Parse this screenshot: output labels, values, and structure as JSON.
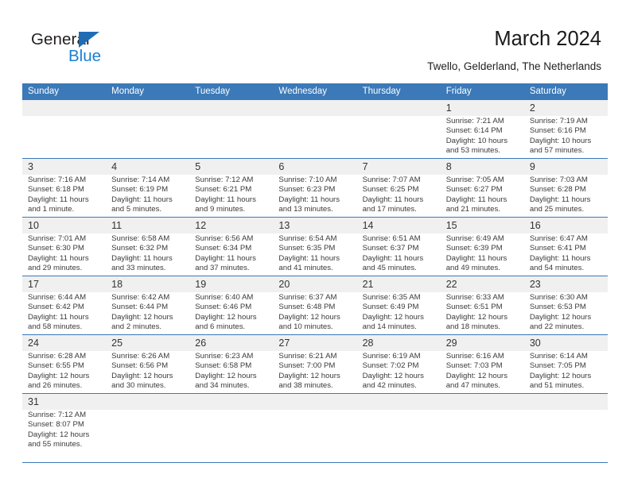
{
  "brand": {
    "name_top": "General",
    "name_bottom": "Blue",
    "accent_color": "#1a7fd4",
    "triangle_color": "#1f6cb4"
  },
  "header": {
    "title": "March 2024",
    "subtitle": "Twello, Gelderland, The Netherlands",
    "header_bg_color": "#3b79b8",
    "band_color": "#f0f0f0"
  },
  "weekdays": [
    "Sunday",
    "Monday",
    "Tuesday",
    "Wednesday",
    "Thursday",
    "Friday",
    "Saturday"
  ],
  "weeks": [
    [
      {
        "day": "",
        "sunrise": "",
        "sunset": "",
        "daylight1": "",
        "daylight2": ""
      },
      {
        "day": "",
        "sunrise": "",
        "sunset": "",
        "daylight1": "",
        "daylight2": ""
      },
      {
        "day": "",
        "sunrise": "",
        "sunset": "",
        "daylight1": "",
        "daylight2": ""
      },
      {
        "day": "",
        "sunrise": "",
        "sunset": "",
        "daylight1": "",
        "daylight2": ""
      },
      {
        "day": "",
        "sunrise": "",
        "sunset": "",
        "daylight1": "",
        "daylight2": ""
      },
      {
        "day": "1",
        "sunrise": "Sunrise: 7:21 AM",
        "sunset": "Sunset: 6:14 PM",
        "daylight1": "Daylight: 10 hours",
        "daylight2": "and 53 minutes."
      },
      {
        "day": "2",
        "sunrise": "Sunrise: 7:19 AM",
        "sunset": "Sunset: 6:16 PM",
        "daylight1": "Daylight: 10 hours",
        "daylight2": "and 57 minutes."
      }
    ],
    [
      {
        "day": "3",
        "sunrise": "Sunrise: 7:16 AM",
        "sunset": "Sunset: 6:18 PM",
        "daylight1": "Daylight: 11 hours",
        "daylight2": "and 1 minute."
      },
      {
        "day": "4",
        "sunrise": "Sunrise: 7:14 AM",
        "sunset": "Sunset: 6:19 PM",
        "daylight1": "Daylight: 11 hours",
        "daylight2": "and 5 minutes."
      },
      {
        "day": "5",
        "sunrise": "Sunrise: 7:12 AM",
        "sunset": "Sunset: 6:21 PM",
        "daylight1": "Daylight: 11 hours",
        "daylight2": "and 9 minutes."
      },
      {
        "day": "6",
        "sunrise": "Sunrise: 7:10 AM",
        "sunset": "Sunset: 6:23 PM",
        "daylight1": "Daylight: 11 hours",
        "daylight2": "and 13 minutes."
      },
      {
        "day": "7",
        "sunrise": "Sunrise: 7:07 AM",
        "sunset": "Sunset: 6:25 PM",
        "daylight1": "Daylight: 11 hours",
        "daylight2": "and 17 minutes."
      },
      {
        "day": "8",
        "sunrise": "Sunrise: 7:05 AM",
        "sunset": "Sunset: 6:27 PM",
        "daylight1": "Daylight: 11 hours",
        "daylight2": "and 21 minutes."
      },
      {
        "day": "9",
        "sunrise": "Sunrise: 7:03 AM",
        "sunset": "Sunset: 6:28 PM",
        "daylight1": "Daylight: 11 hours",
        "daylight2": "and 25 minutes."
      }
    ],
    [
      {
        "day": "10",
        "sunrise": "Sunrise: 7:01 AM",
        "sunset": "Sunset: 6:30 PM",
        "daylight1": "Daylight: 11 hours",
        "daylight2": "and 29 minutes."
      },
      {
        "day": "11",
        "sunrise": "Sunrise: 6:58 AM",
        "sunset": "Sunset: 6:32 PM",
        "daylight1": "Daylight: 11 hours",
        "daylight2": "and 33 minutes."
      },
      {
        "day": "12",
        "sunrise": "Sunrise: 6:56 AM",
        "sunset": "Sunset: 6:34 PM",
        "daylight1": "Daylight: 11 hours",
        "daylight2": "and 37 minutes."
      },
      {
        "day": "13",
        "sunrise": "Sunrise: 6:54 AM",
        "sunset": "Sunset: 6:35 PM",
        "daylight1": "Daylight: 11 hours",
        "daylight2": "and 41 minutes."
      },
      {
        "day": "14",
        "sunrise": "Sunrise: 6:51 AM",
        "sunset": "Sunset: 6:37 PM",
        "daylight1": "Daylight: 11 hours",
        "daylight2": "and 45 minutes."
      },
      {
        "day": "15",
        "sunrise": "Sunrise: 6:49 AM",
        "sunset": "Sunset: 6:39 PM",
        "daylight1": "Daylight: 11 hours",
        "daylight2": "and 49 minutes."
      },
      {
        "day": "16",
        "sunrise": "Sunrise: 6:47 AM",
        "sunset": "Sunset: 6:41 PM",
        "daylight1": "Daylight: 11 hours",
        "daylight2": "and 54 minutes."
      }
    ],
    [
      {
        "day": "17",
        "sunrise": "Sunrise: 6:44 AM",
        "sunset": "Sunset: 6:42 PM",
        "daylight1": "Daylight: 11 hours",
        "daylight2": "and 58 minutes."
      },
      {
        "day": "18",
        "sunrise": "Sunrise: 6:42 AM",
        "sunset": "Sunset: 6:44 PM",
        "daylight1": "Daylight: 12 hours",
        "daylight2": "and 2 minutes."
      },
      {
        "day": "19",
        "sunrise": "Sunrise: 6:40 AM",
        "sunset": "Sunset: 6:46 PM",
        "daylight1": "Daylight: 12 hours",
        "daylight2": "and 6 minutes."
      },
      {
        "day": "20",
        "sunrise": "Sunrise: 6:37 AM",
        "sunset": "Sunset: 6:48 PM",
        "daylight1": "Daylight: 12 hours",
        "daylight2": "and 10 minutes."
      },
      {
        "day": "21",
        "sunrise": "Sunrise: 6:35 AM",
        "sunset": "Sunset: 6:49 PM",
        "daylight1": "Daylight: 12 hours",
        "daylight2": "and 14 minutes."
      },
      {
        "day": "22",
        "sunrise": "Sunrise: 6:33 AM",
        "sunset": "Sunset: 6:51 PM",
        "daylight1": "Daylight: 12 hours",
        "daylight2": "and 18 minutes."
      },
      {
        "day": "23",
        "sunrise": "Sunrise: 6:30 AM",
        "sunset": "Sunset: 6:53 PM",
        "daylight1": "Daylight: 12 hours",
        "daylight2": "and 22 minutes."
      }
    ],
    [
      {
        "day": "24",
        "sunrise": "Sunrise: 6:28 AM",
        "sunset": "Sunset: 6:55 PM",
        "daylight1": "Daylight: 12 hours",
        "daylight2": "and 26 minutes."
      },
      {
        "day": "25",
        "sunrise": "Sunrise: 6:26 AM",
        "sunset": "Sunset: 6:56 PM",
        "daylight1": "Daylight: 12 hours",
        "daylight2": "and 30 minutes."
      },
      {
        "day": "26",
        "sunrise": "Sunrise: 6:23 AM",
        "sunset": "Sunset: 6:58 PM",
        "daylight1": "Daylight: 12 hours",
        "daylight2": "and 34 minutes."
      },
      {
        "day": "27",
        "sunrise": "Sunrise: 6:21 AM",
        "sunset": "Sunset: 7:00 PM",
        "daylight1": "Daylight: 12 hours",
        "daylight2": "and 38 minutes."
      },
      {
        "day": "28",
        "sunrise": "Sunrise: 6:19 AM",
        "sunset": "Sunset: 7:02 PM",
        "daylight1": "Daylight: 12 hours",
        "daylight2": "and 42 minutes."
      },
      {
        "day": "29",
        "sunrise": "Sunrise: 6:16 AM",
        "sunset": "Sunset: 7:03 PM",
        "daylight1": "Daylight: 12 hours",
        "daylight2": "and 47 minutes."
      },
      {
        "day": "30",
        "sunrise": "Sunrise: 6:14 AM",
        "sunset": "Sunset: 7:05 PM",
        "daylight1": "Daylight: 12 hours",
        "daylight2": "and 51 minutes."
      }
    ],
    [
      {
        "day": "31",
        "sunrise": "Sunrise: 7:12 AM",
        "sunset": "Sunset: 8:07 PM",
        "daylight1": "Daylight: 12 hours",
        "daylight2": "and 55 minutes."
      },
      {
        "day": "",
        "sunrise": "",
        "sunset": "",
        "daylight1": "",
        "daylight2": ""
      },
      {
        "day": "",
        "sunrise": "",
        "sunset": "",
        "daylight1": "",
        "daylight2": ""
      },
      {
        "day": "",
        "sunrise": "",
        "sunset": "",
        "daylight1": "",
        "daylight2": ""
      },
      {
        "day": "",
        "sunrise": "",
        "sunset": "",
        "daylight1": "",
        "daylight2": ""
      },
      {
        "day": "",
        "sunrise": "",
        "sunset": "",
        "daylight1": "",
        "daylight2": ""
      },
      {
        "day": "",
        "sunrise": "",
        "sunset": "",
        "daylight1": "",
        "daylight2": ""
      }
    ]
  ]
}
